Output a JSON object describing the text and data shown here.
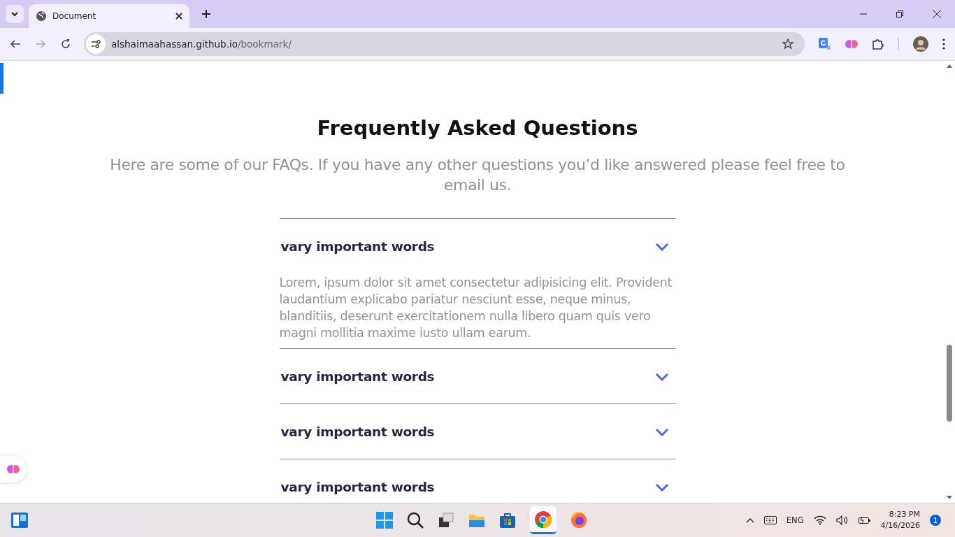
{
  "browser": {
    "tab_title": "Document",
    "url_host": "alshaimaahassan.github.io",
    "url_path": "/bookmark/"
  },
  "faq": {
    "title": "Frequently Asked Questions",
    "intro": "Here are some of our FAQs. If you have any other questions you’d like answered please feel free to email us.",
    "items": [
      {
        "question": "vary important words",
        "answer": "Lorem, ipsum dolor sit amet consectetur adipisicing elit. Provident laudantium explicabo pariatur nesciunt esse, neque minus, blanditiis, deserunt exercitationem nulla libero quam quis vero magni mollitia maxime iusto ullam earum."
      },
      {
        "question": "vary important words"
      },
      {
        "question": "vary important words"
      },
      {
        "question": "vary important words"
      }
    ]
  },
  "taskbar": {
    "language": "ENG",
    "time": "8:23 PM",
    "date": "4/16/2026",
    "notifications": "1"
  }
}
